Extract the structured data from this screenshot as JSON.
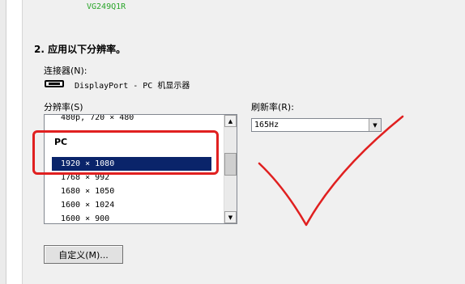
{
  "monitor": {
    "name": "VG249Q1R"
  },
  "step": {
    "title": "2. 应用以下分辨率。"
  },
  "connector": {
    "label": "连接器(N):",
    "icon": "displayport-connector-icon",
    "value": "DisplayPort - PC 机显示器"
  },
  "resolution": {
    "label": "分辨率(S)",
    "items": [
      {
        "type": "item",
        "text": "480p, 720 × 480"
      },
      {
        "type": "group",
        "text": "PC"
      },
      {
        "type": "item",
        "text": "1920 × 1080",
        "selected": true
      },
      {
        "type": "item",
        "text": "1768 × 992"
      },
      {
        "type": "item",
        "text": "1680 × 1050"
      },
      {
        "type": "item",
        "text": "1600 × 1024"
      },
      {
        "type": "item",
        "text": "1600 × 900"
      }
    ]
  },
  "refresh": {
    "label": "刷新率(R):",
    "value": "165Hz"
  },
  "custom_button": {
    "label": "自定义(M)..."
  },
  "colors": {
    "selection": "#0a246a",
    "annotation": "#e02020",
    "monitor_name": "#2aa52a"
  }
}
